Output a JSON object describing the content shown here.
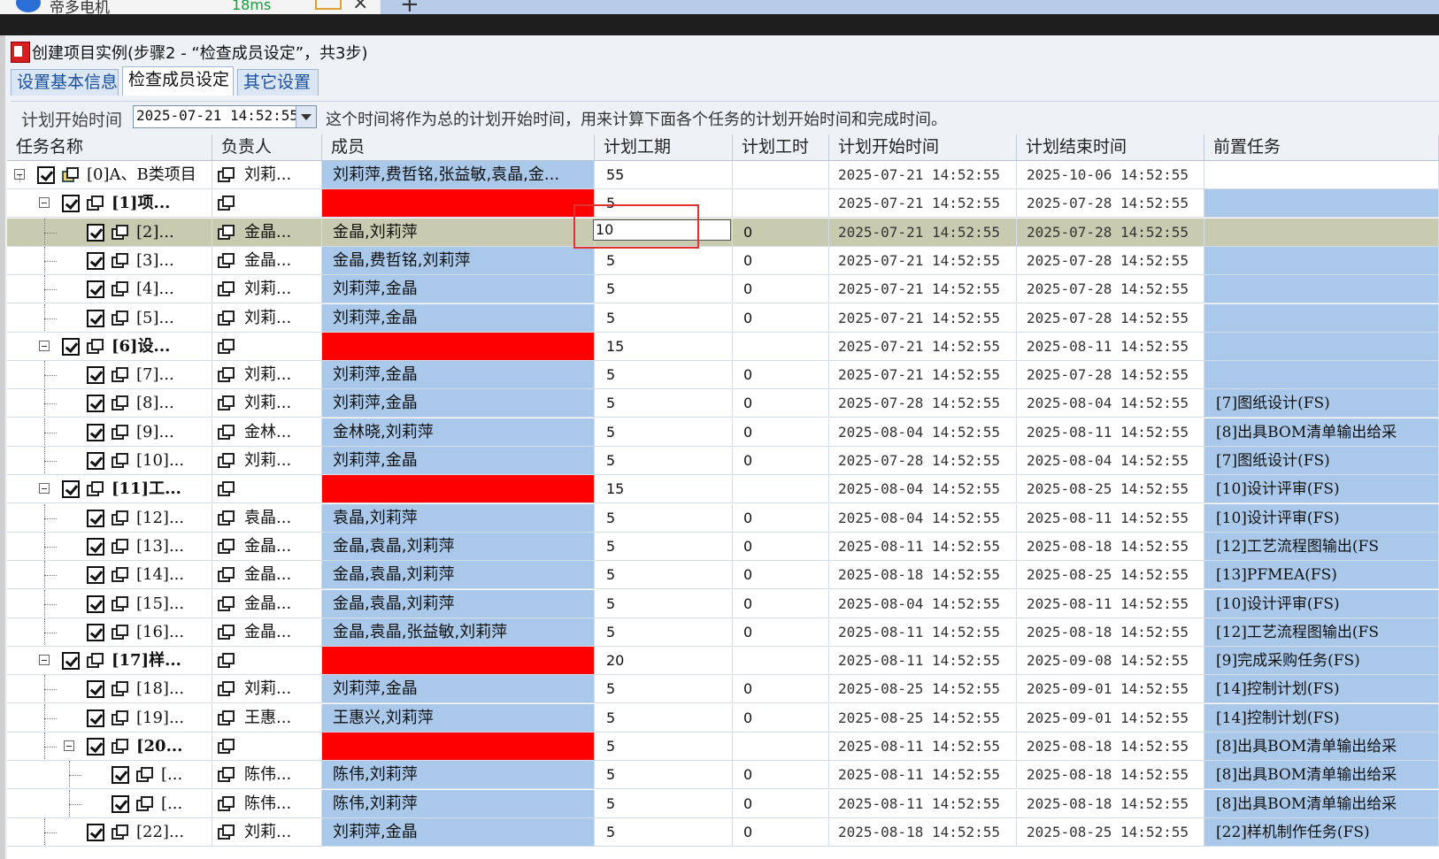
{
  "browser": {
    "tab_title": "帝多电机",
    "tab_stat": "18ms",
    "new_tab": "+"
  },
  "window": {
    "title": "创建项目实例(步骤2 - “检查成员设定”，共3步)"
  },
  "tabs": [
    {
      "label": "设置基本信息"
    },
    {
      "label": "检查成员设定"
    },
    {
      "label": "其它设置"
    }
  ],
  "start": {
    "label": "计划开始时间",
    "value": "2025-07-21 14:52:55",
    "hint": "这个时间将作为总的计划开始时间，用来计算下面各个任务的计划开始时间和完成时间。"
  },
  "columns": [
    "任务名称",
    "负责人",
    "成员",
    "计划工期",
    "计划工时",
    "计划开始时间",
    "计划结束时间",
    "前置任务"
  ],
  "edit_value": "10",
  "rows": [
    {
      "name": "[0]A、B类项目",
      "owner": "刘莉...",
      "members": "刘莉萍,费哲铭,张益敏,袁晶,金...",
      "dur": "55",
      "hours": "",
      "start": "2025-07-21 14:52:55",
      "end": "2025-10-06 14:52:55",
      "pred": ""
    },
    {
      "name": "[1]项...",
      "owner": "",
      "members": "",
      "dur": "5",
      "hours": "",
      "start": "2025-07-21 14:52:55",
      "end": "2025-07-28 14:52:55",
      "pred": ""
    },
    {
      "name": "[2]...",
      "owner": "金晶...",
      "members": "金晶,刘莉萍",
      "dur": "",
      "hours": "0",
      "start": "2025-07-21 14:52:55",
      "end": "2025-07-28 14:52:55",
      "pred": ""
    },
    {
      "name": "[3]...",
      "owner": "金晶...",
      "members": "金晶,费哲铭,刘莉萍",
      "dur": "5",
      "hours": "0",
      "start": "2025-07-21 14:52:55",
      "end": "2025-07-28 14:52:55",
      "pred": ""
    },
    {
      "name": "[4]...",
      "owner": "刘莉...",
      "members": "刘莉萍,金晶",
      "dur": "5",
      "hours": "0",
      "start": "2025-07-21 14:52:55",
      "end": "2025-07-28 14:52:55",
      "pred": ""
    },
    {
      "name": "[5]...",
      "owner": "刘莉...",
      "members": "刘莉萍,金晶",
      "dur": "5",
      "hours": "0",
      "start": "2025-07-21 14:52:55",
      "end": "2025-07-28 14:52:55",
      "pred": ""
    },
    {
      "name": "[6]设...",
      "owner": "",
      "members": "",
      "dur": "15",
      "hours": "",
      "start": "2025-07-21 14:52:55",
      "end": "2025-08-11 14:52:55",
      "pred": ""
    },
    {
      "name": "[7]...",
      "owner": "刘莉...",
      "members": "刘莉萍,金晶",
      "dur": "5",
      "hours": "0",
      "start": "2025-07-21 14:52:55",
      "end": "2025-07-28 14:52:55",
      "pred": ""
    },
    {
      "name": "[8]...",
      "owner": "刘莉...",
      "members": "刘莉萍,金晶",
      "dur": "5",
      "hours": "0",
      "start": "2025-07-28 14:52:55",
      "end": "2025-08-04 14:52:55",
      "pred": "[7]图纸设计(FS)"
    },
    {
      "name": "[9]...",
      "owner": "金林...",
      "members": "金林晓,刘莉萍",
      "dur": "5",
      "hours": "0",
      "start": "2025-08-04 14:52:55",
      "end": "2025-08-11 14:52:55",
      "pred": "[8]出具BOM清单输出给采"
    },
    {
      "name": "[10]...",
      "owner": "刘莉...",
      "members": "刘莉萍,金晶",
      "dur": "5",
      "hours": "0",
      "start": "2025-07-28 14:52:55",
      "end": "2025-08-04 14:52:55",
      "pred": "[7]图纸设计(FS)"
    },
    {
      "name": "[11]工...",
      "owner": "",
      "members": "",
      "dur": "15",
      "hours": "",
      "start": "2025-08-04 14:52:55",
      "end": "2025-08-25 14:52:55",
      "pred": "[10]设计评审(FS)"
    },
    {
      "name": "[12]...",
      "owner": "袁晶...",
      "members": "袁晶,刘莉萍",
      "dur": "5",
      "hours": "0",
      "start": "2025-08-04 14:52:55",
      "end": "2025-08-11 14:52:55",
      "pred": "[10]设计评审(FS)"
    },
    {
      "name": "[13]...",
      "owner": "金晶...",
      "members": "金晶,袁晶,刘莉萍",
      "dur": "5",
      "hours": "0",
      "start": "2025-08-11 14:52:55",
      "end": "2025-08-18 14:52:55",
      "pred": "[12]工艺流程图输出(FS"
    },
    {
      "name": "[14]...",
      "owner": "金晶...",
      "members": "金晶,袁晶,刘莉萍",
      "dur": "5",
      "hours": "0",
      "start": "2025-08-18 14:52:55",
      "end": "2025-08-25 14:52:55",
      "pred": "[13]PFMEA(FS)"
    },
    {
      "name": "[15]...",
      "owner": "金晶...",
      "members": "金晶,袁晶,刘莉萍",
      "dur": "5",
      "hours": "0",
      "start": "2025-08-04 14:52:55",
      "end": "2025-08-11 14:52:55",
      "pred": "[10]设计评审(FS)"
    },
    {
      "name": "[16]...",
      "owner": "金晶...",
      "members": "金晶,袁晶,张益敏,刘莉萍",
      "dur": "5",
      "hours": "0",
      "start": "2025-08-11 14:52:55",
      "end": "2025-08-18 14:52:55",
      "pred": "[12]工艺流程图输出(FS"
    },
    {
      "name": "[17]样...",
      "owner": "",
      "members": "",
      "dur": "20",
      "hours": "",
      "start": "2025-08-11 14:52:55",
      "end": "2025-09-08 14:52:55",
      "pred": "[9]完成采购任务(FS)"
    },
    {
      "name": "[18]...",
      "owner": "刘莉...",
      "members": "刘莉萍,金晶",
      "dur": "5",
      "hours": "0",
      "start": "2025-08-25 14:52:55",
      "end": "2025-09-01 14:52:55",
      "pred": "[14]控制计划(FS)"
    },
    {
      "name": "[19]...",
      "owner": "王惠...",
      "members": "王惠兴,刘莉萍",
      "dur": "5",
      "hours": "0",
      "start": "2025-08-25 14:52:55",
      "end": "2025-09-01 14:52:55",
      "pred": "[14]控制计划(FS)"
    },
    {
      "name": "[20...",
      "owner": "",
      "members": "",
      "dur": "5",
      "hours": "",
      "start": "2025-08-11 14:52:55",
      "end": "2025-08-18 14:52:55",
      "pred": "[8]出具BOM清单输出给采"
    },
    {
      "name": "[...",
      "owner": "陈伟...",
      "members": "陈伟,刘莉萍",
      "dur": "5",
      "hours": "0",
      "start": "2025-08-11 14:52:55",
      "end": "2025-08-18 14:52:55",
      "pred": "[8]出具BOM清单输出给采"
    },
    {
      "name": "[...",
      "owner": "陈伟...",
      "members": "陈伟,刘莉萍",
      "dur": "5",
      "hours": "0",
      "start": "2025-08-11 14:52:55",
      "end": "2025-08-18 14:52:55",
      "pred": "[8]出具BOM清单输出给采"
    },
    {
      "name": "[22]...",
      "owner": "刘莉...",
      "members": "刘莉萍,金晶",
      "dur": "5",
      "hours": "0",
      "start": "2025-08-18 14:52:55",
      "end": "2025-08-25 14:52:55",
      "pred": "[22]样机制作任务(FS)"
    }
  ],
  "colors": {
    "member_cell": "#a9c8ea",
    "summary_red": "#ff0000",
    "selected_row": "#c9cbb0",
    "highlight_outline": "#e03030"
  }
}
